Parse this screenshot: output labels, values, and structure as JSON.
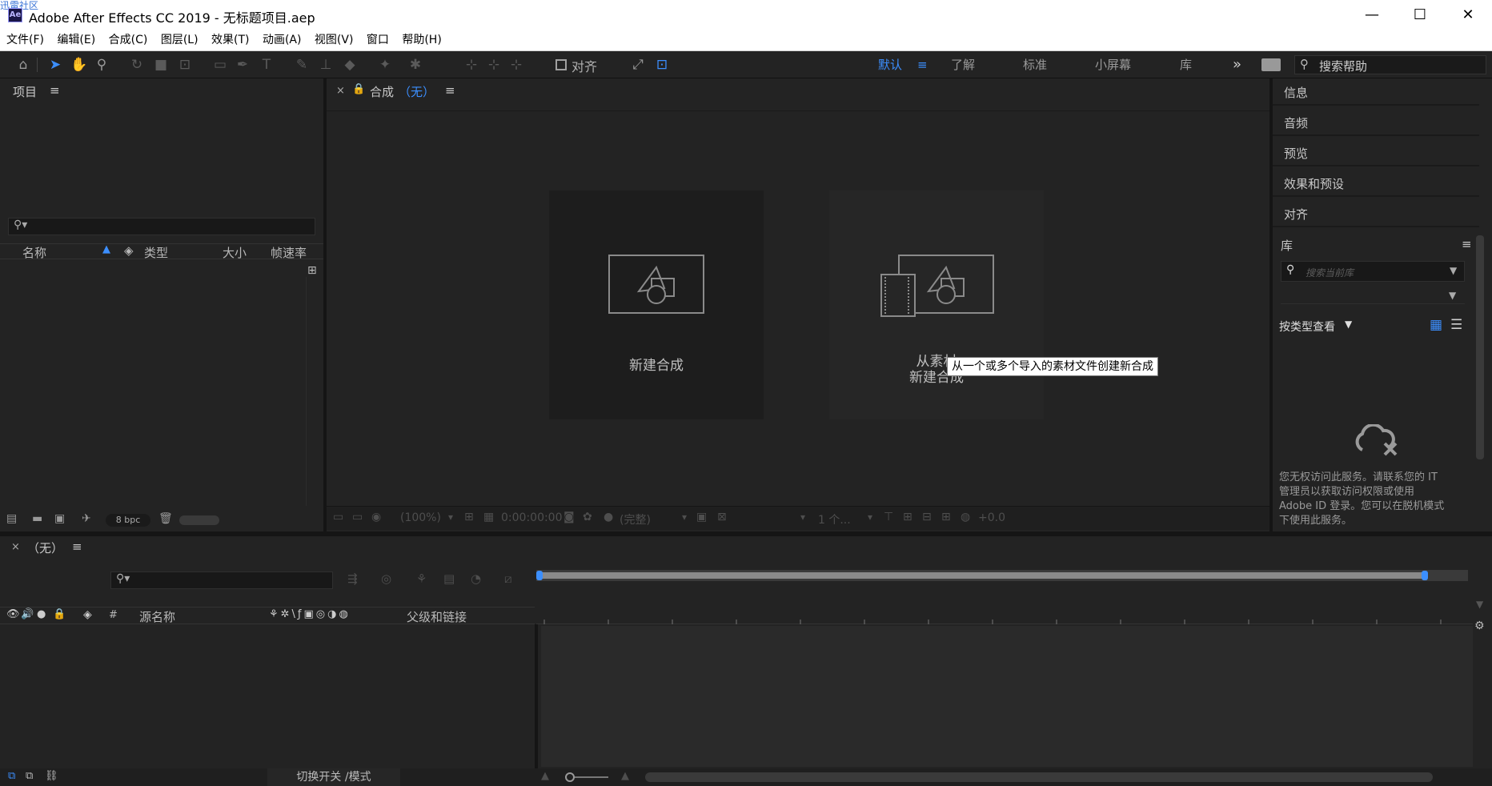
{
  "watermark": "迅雷社区",
  "window": {
    "title": "Adobe After Effects CC 2019 - 无标题项目.aep",
    "icon": "Ae",
    "minimize": "—",
    "maximize": "☐",
    "close": "✕"
  },
  "menu": [
    "文件(F)",
    "编辑(E)",
    "合成(C)",
    "图层(L)",
    "效果(T)",
    "动画(A)",
    "视图(V)",
    "窗口",
    "帮助(H)"
  ],
  "toolbar": {
    "align_label": "对齐",
    "workspaces": [
      "默认",
      "了解",
      "标准",
      "小屏幕",
      "库"
    ],
    "active_workspace": "默认",
    "more": "»",
    "help_search_placeholder": "搜索帮助"
  },
  "project_panel": {
    "title": "项目",
    "menu_icon": "≡",
    "columns": [
      "名称",
      "类型",
      "大小",
      "帧速率"
    ],
    "bpc": "8 bpc"
  },
  "composition_panel": {
    "close": "×",
    "title": "合成",
    "comp_name": "（无）",
    "menu_icon": "≡",
    "new_comp_label": "新建合成",
    "from_footage_line1": "从素材",
    "from_footage_line2": "新建合成",
    "tooltip": "从一个或多个导入的素材文件创建新合成",
    "footer": {
      "zoom": "(100%)",
      "timecode": "0:00:00:00",
      "resolution": "(完整)",
      "views": "1 个...",
      "exposure": "+0.0"
    }
  },
  "right_panels": {
    "items": [
      "信息",
      "音频",
      "预览",
      "效果和预设",
      "对齐"
    ],
    "library": {
      "title": "库",
      "search_placeholder": "搜索当前库",
      "view_by": "按类型查看",
      "message": "您无权访问此服务。请联系您的 IT 管理员以获取访问权限或使用 Adobe ID 登录。您可以在脱机模式下使用此服务。"
    }
  },
  "timeline": {
    "close": "×",
    "title": "（无）",
    "menu_icon": "≡",
    "columns": {
      "hash": "#",
      "source_name": "源名称",
      "parent": "父级和链接"
    },
    "toggle_modes": "切换开关 /模式"
  },
  "colors": {
    "accent": "#3c8fff",
    "panel_bg": "#232323",
    "dark_bg": "#1d1d1d"
  }
}
